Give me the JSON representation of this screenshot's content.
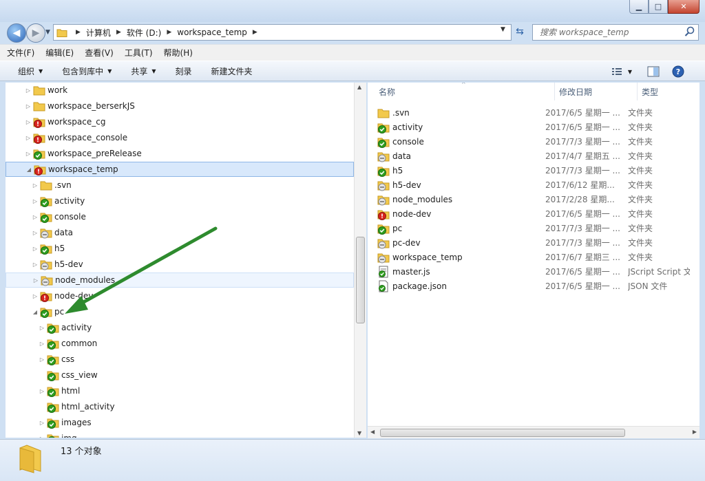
{
  "window": {
    "minimize": "▁",
    "maximize": "□",
    "close": "✕"
  },
  "address": {
    "crumbs": [
      "计算机",
      "软件 (D:)",
      "workspace_temp"
    ]
  },
  "search": {
    "placeholder": "搜索 workspace_temp"
  },
  "menu": [
    "文件(F)",
    "编辑(E)",
    "查看(V)",
    "工具(T)",
    "帮助(H)"
  ],
  "toolbar": {
    "organize": "组织",
    "include_in_library": "包含到库中",
    "share": "共享",
    "burn": "刻录",
    "new_folder": "新建文件夹"
  },
  "tree": [
    {
      "label": "work",
      "icon": "folder",
      "depth": 0,
      "state": "collapsed"
    },
    {
      "label": "workspace_berserkJS",
      "icon": "folder",
      "depth": 0,
      "state": "collapsed"
    },
    {
      "label": "workspace_cg",
      "icon": "svn-conflict",
      "depth": 0,
      "state": "collapsed"
    },
    {
      "label": "workspace_console",
      "icon": "svn-conflict",
      "depth": 0,
      "state": "collapsed"
    },
    {
      "label": "workspace_preRelease",
      "icon": "svn-ok",
      "depth": 0,
      "state": "collapsed"
    },
    {
      "label": "workspace_temp",
      "icon": "svn-conflict",
      "depth": 0,
      "state": "expanded",
      "selected": true
    },
    {
      "label": ".svn",
      "icon": "folder",
      "depth": 1,
      "state": "collapsed"
    },
    {
      "label": "activity",
      "icon": "svn-ok",
      "depth": 1,
      "state": "collapsed"
    },
    {
      "label": "console",
      "icon": "svn-ok",
      "depth": 1,
      "state": "collapsed"
    },
    {
      "label": "data",
      "icon": "svn-normal",
      "depth": 1,
      "state": "collapsed"
    },
    {
      "label": "h5",
      "icon": "svn-ok",
      "depth": 1,
      "state": "collapsed"
    },
    {
      "label": "h5-dev",
      "icon": "svn-normal",
      "depth": 1,
      "state": "collapsed"
    },
    {
      "label": "node_modules",
      "icon": "svn-normal",
      "depth": 1,
      "state": "collapsed",
      "hover": true
    },
    {
      "label": "node-dev",
      "icon": "svn-conflict",
      "depth": 1,
      "state": "collapsed"
    },
    {
      "label": "pc",
      "icon": "svn-ok",
      "depth": 1,
      "state": "expanded"
    },
    {
      "label": "activity",
      "icon": "svn-ok",
      "depth": 2,
      "state": "collapsed"
    },
    {
      "label": "common",
      "icon": "svn-ok",
      "depth": 2,
      "state": "collapsed"
    },
    {
      "label": "css",
      "icon": "svn-ok",
      "depth": 2,
      "state": "collapsed"
    },
    {
      "label": "css_view",
      "icon": "svn-ok",
      "depth": 2,
      "state": "none"
    },
    {
      "label": "html",
      "icon": "svn-ok",
      "depth": 2,
      "state": "collapsed"
    },
    {
      "label": "html_activity",
      "icon": "svn-ok",
      "depth": 2,
      "state": "none"
    },
    {
      "label": "images",
      "icon": "svn-ok",
      "depth": 2,
      "state": "collapsed"
    },
    {
      "label": "img",
      "icon": "svn-ok",
      "depth": 2,
      "state": "collapsed"
    }
  ],
  "columns": [
    "名称",
    "修改日期",
    "类型"
  ],
  "files": [
    {
      "name": ".svn",
      "date": "2017/6/5 星期一 ...",
      "type": "文件夹",
      "icon": "folder"
    },
    {
      "name": "activity",
      "date": "2017/6/5 星期一 ...",
      "type": "文件夹",
      "icon": "svn-ok"
    },
    {
      "name": "console",
      "date": "2017/7/3 星期一 ...",
      "type": "文件夹",
      "icon": "svn-ok"
    },
    {
      "name": "data",
      "date": "2017/4/7 星期五 ...",
      "type": "文件夹",
      "icon": "svn-normal"
    },
    {
      "name": "h5",
      "date": "2017/7/3 星期一 ...",
      "type": "文件夹",
      "icon": "svn-ok"
    },
    {
      "name": "h5-dev",
      "date": "2017/6/12 星期...",
      "type": "文件夹",
      "icon": "svn-normal"
    },
    {
      "name": "node_modules",
      "date": "2017/2/28 星期...",
      "type": "文件夹",
      "icon": "svn-normal"
    },
    {
      "name": "node-dev",
      "date": "2017/6/5 星期一 ...",
      "type": "文件夹",
      "icon": "svn-conflict"
    },
    {
      "name": "pc",
      "date": "2017/7/3 星期一 ...",
      "type": "文件夹",
      "icon": "svn-ok"
    },
    {
      "name": "pc-dev",
      "date": "2017/7/3 星期一 ...",
      "type": "文件夹",
      "icon": "svn-normal"
    },
    {
      "name": "workspace_temp",
      "date": "2017/6/7 星期三 ...",
      "type": "文件夹",
      "icon": "svn-normal"
    },
    {
      "name": "master.js",
      "date": "2017/6/5 星期一 ...",
      "type": "JScript Script 文件",
      "icon": "js-file"
    },
    {
      "name": "package.json",
      "date": "2017/6/5 星期一 ...",
      "type": "JSON 文件",
      "icon": "json-file"
    }
  ],
  "status": {
    "count": "13 个对象"
  },
  "colors": {
    "svn_ok": "#2f9e1f",
    "svn_conflict": "#d8231d",
    "folder": "#f2c94c",
    "arrow": "#2e8b2e",
    "selection": "#d8e8fb"
  }
}
